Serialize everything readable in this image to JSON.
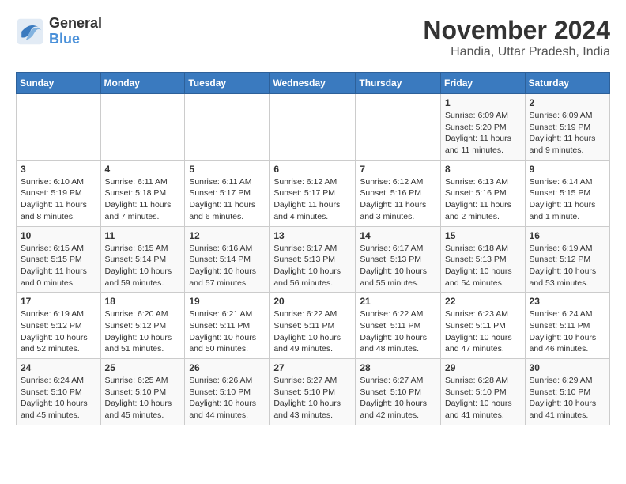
{
  "logo": {
    "line1": "General",
    "line2": "Blue"
  },
  "title": "November 2024",
  "subtitle": "Handia, Uttar Pradesh, India",
  "days_of_week": [
    "Sunday",
    "Monday",
    "Tuesday",
    "Wednesday",
    "Thursday",
    "Friday",
    "Saturday"
  ],
  "weeks": [
    [
      {
        "day": "",
        "info": ""
      },
      {
        "day": "",
        "info": ""
      },
      {
        "day": "",
        "info": ""
      },
      {
        "day": "",
        "info": ""
      },
      {
        "day": "",
        "info": ""
      },
      {
        "day": "1",
        "info": "Sunrise: 6:09 AM\nSunset: 5:20 PM\nDaylight: 11 hours and 11 minutes."
      },
      {
        "day": "2",
        "info": "Sunrise: 6:09 AM\nSunset: 5:19 PM\nDaylight: 11 hours and 9 minutes."
      }
    ],
    [
      {
        "day": "3",
        "info": "Sunrise: 6:10 AM\nSunset: 5:19 PM\nDaylight: 11 hours and 8 minutes."
      },
      {
        "day": "4",
        "info": "Sunrise: 6:11 AM\nSunset: 5:18 PM\nDaylight: 11 hours and 7 minutes."
      },
      {
        "day": "5",
        "info": "Sunrise: 6:11 AM\nSunset: 5:17 PM\nDaylight: 11 hours and 6 minutes."
      },
      {
        "day": "6",
        "info": "Sunrise: 6:12 AM\nSunset: 5:17 PM\nDaylight: 11 hours and 4 minutes."
      },
      {
        "day": "7",
        "info": "Sunrise: 6:12 AM\nSunset: 5:16 PM\nDaylight: 11 hours and 3 minutes."
      },
      {
        "day": "8",
        "info": "Sunrise: 6:13 AM\nSunset: 5:16 PM\nDaylight: 11 hours and 2 minutes."
      },
      {
        "day": "9",
        "info": "Sunrise: 6:14 AM\nSunset: 5:15 PM\nDaylight: 11 hours and 1 minute."
      }
    ],
    [
      {
        "day": "10",
        "info": "Sunrise: 6:15 AM\nSunset: 5:15 PM\nDaylight: 11 hours and 0 minutes."
      },
      {
        "day": "11",
        "info": "Sunrise: 6:15 AM\nSunset: 5:14 PM\nDaylight: 10 hours and 59 minutes."
      },
      {
        "day": "12",
        "info": "Sunrise: 6:16 AM\nSunset: 5:14 PM\nDaylight: 10 hours and 57 minutes."
      },
      {
        "day": "13",
        "info": "Sunrise: 6:17 AM\nSunset: 5:13 PM\nDaylight: 10 hours and 56 minutes."
      },
      {
        "day": "14",
        "info": "Sunrise: 6:17 AM\nSunset: 5:13 PM\nDaylight: 10 hours and 55 minutes."
      },
      {
        "day": "15",
        "info": "Sunrise: 6:18 AM\nSunset: 5:13 PM\nDaylight: 10 hours and 54 minutes."
      },
      {
        "day": "16",
        "info": "Sunrise: 6:19 AM\nSunset: 5:12 PM\nDaylight: 10 hours and 53 minutes."
      }
    ],
    [
      {
        "day": "17",
        "info": "Sunrise: 6:19 AM\nSunset: 5:12 PM\nDaylight: 10 hours and 52 minutes."
      },
      {
        "day": "18",
        "info": "Sunrise: 6:20 AM\nSunset: 5:12 PM\nDaylight: 10 hours and 51 minutes."
      },
      {
        "day": "19",
        "info": "Sunrise: 6:21 AM\nSunset: 5:11 PM\nDaylight: 10 hours and 50 minutes."
      },
      {
        "day": "20",
        "info": "Sunrise: 6:22 AM\nSunset: 5:11 PM\nDaylight: 10 hours and 49 minutes."
      },
      {
        "day": "21",
        "info": "Sunrise: 6:22 AM\nSunset: 5:11 PM\nDaylight: 10 hours and 48 minutes."
      },
      {
        "day": "22",
        "info": "Sunrise: 6:23 AM\nSunset: 5:11 PM\nDaylight: 10 hours and 47 minutes."
      },
      {
        "day": "23",
        "info": "Sunrise: 6:24 AM\nSunset: 5:11 PM\nDaylight: 10 hours and 46 minutes."
      }
    ],
    [
      {
        "day": "24",
        "info": "Sunrise: 6:24 AM\nSunset: 5:10 PM\nDaylight: 10 hours and 45 minutes."
      },
      {
        "day": "25",
        "info": "Sunrise: 6:25 AM\nSunset: 5:10 PM\nDaylight: 10 hours and 45 minutes."
      },
      {
        "day": "26",
        "info": "Sunrise: 6:26 AM\nSunset: 5:10 PM\nDaylight: 10 hours and 44 minutes."
      },
      {
        "day": "27",
        "info": "Sunrise: 6:27 AM\nSunset: 5:10 PM\nDaylight: 10 hours and 43 minutes."
      },
      {
        "day": "28",
        "info": "Sunrise: 6:27 AM\nSunset: 5:10 PM\nDaylight: 10 hours and 42 minutes."
      },
      {
        "day": "29",
        "info": "Sunrise: 6:28 AM\nSunset: 5:10 PM\nDaylight: 10 hours and 41 minutes."
      },
      {
        "day": "30",
        "info": "Sunrise: 6:29 AM\nSunset: 5:10 PM\nDaylight: 10 hours and 41 minutes."
      }
    ]
  ]
}
